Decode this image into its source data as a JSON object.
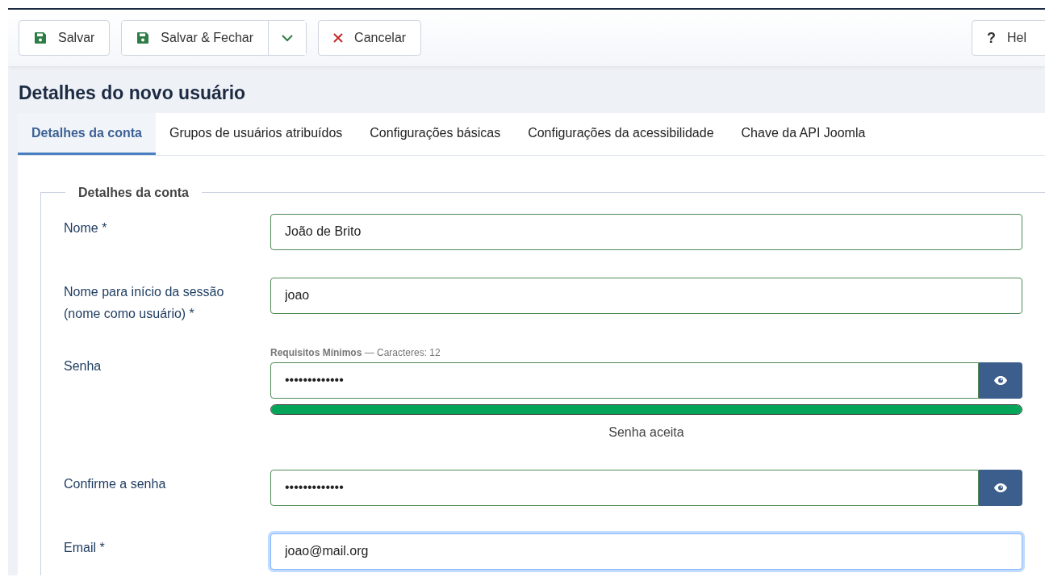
{
  "toolbar": {
    "buttons": [
      {
        "kind": "save",
        "label": "Salvar"
      },
      {
        "kind": "save-split",
        "label": "Salvar & Fechar"
      },
      {
        "kind": "cancel",
        "label": "Cancelar"
      }
    ],
    "help": {
      "icon": "?",
      "label": "Hel"
    }
  },
  "page_title": "Detalhes do novo usuário",
  "tabs": [
    {
      "label": "Detalhes da conta",
      "selected": true
    },
    {
      "label": "Grupos de usuários atribuídos",
      "selected": false
    },
    {
      "label": "Configurações básicas",
      "selected": false
    },
    {
      "label": "Configurações da acessibilidade",
      "selected": false
    },
    {
      "label": "Chave da API Joomla",
      "selected": false
    }
  ],
  "fieldset": {
    "legend": "Detalhes da conta",
    "fields": [
      {
        "kind": "text",
        "label": "Nome *",
        "value": "João de Brito",
        "valid": true,
        "focused": false
      },
      {
        "kind": "text",
        "label": "Nome para início da sessão (nome como usuário) *",
        "value": "joao",
        "valid": true,
        "focused": false
      },
      {
        "kind": "password",
        "label": "Senha",
        "hint_bold": "Requisitos Mínimos",
        "hint": "— Caracteres: 12",
        "value": "•••••••••••••",
        "valid": true,
        "focused": false,
        "strength": {
          "level": 1.0,
          "reading": "Senha aceita"
        }
      },
      {
        "kind": "password",
        "label": "Confirme a senha",
        "value": "•••••••••••••",
        "valid": true,
        "focused": false
      },
      {
        "kind": "text",
        "label": "Email *",
        "value": "joao@mail.org",
        "valid": false,
        "focused": true
      }
    ]
  }
}
